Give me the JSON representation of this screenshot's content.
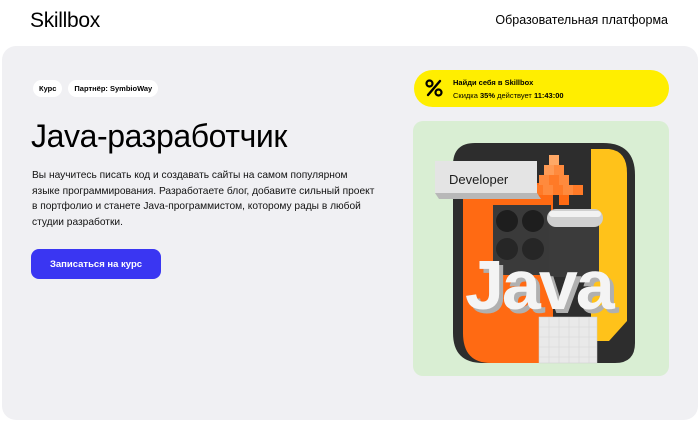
{
  "header": {
    "logo": "Skillbox",
    "tagline": "Образовательная платформа"
  },
  "hero": {
    "badges": [
      "Курс",
      "Партнёр: SymbioWay"
    ],
    "title": "Java-разработчик",
    "description": "Вы научитесь писать код и создавать сайты на самом популярном языке программирования. Разработаете блог, добавите сильный проект в портфолио и станете Java-программистом, которому рады в любой студии разработки.",
    "cta_label": "Записаться на курс"
  },
  "promo": {
    "icon": "percent-icon",
    "title": "Найди себя в Skillbox",
    "discount_prefix": "Скидка",
    "discount_value": "35%",
    "discount_middle": "действует",
    "timer": "11:43:00"
  },
  "illustration": {
    "label_developer": "Developer",
    "label_java": "Java"
  },
  "colors": {
    "accent": "#3a36f2",
    "promo": "#ffee00",
    "hero_bg": "#f0f0f3",
    "art_bg": "#d9eed3",
    "orange": "#ff6a13"
  }
}
